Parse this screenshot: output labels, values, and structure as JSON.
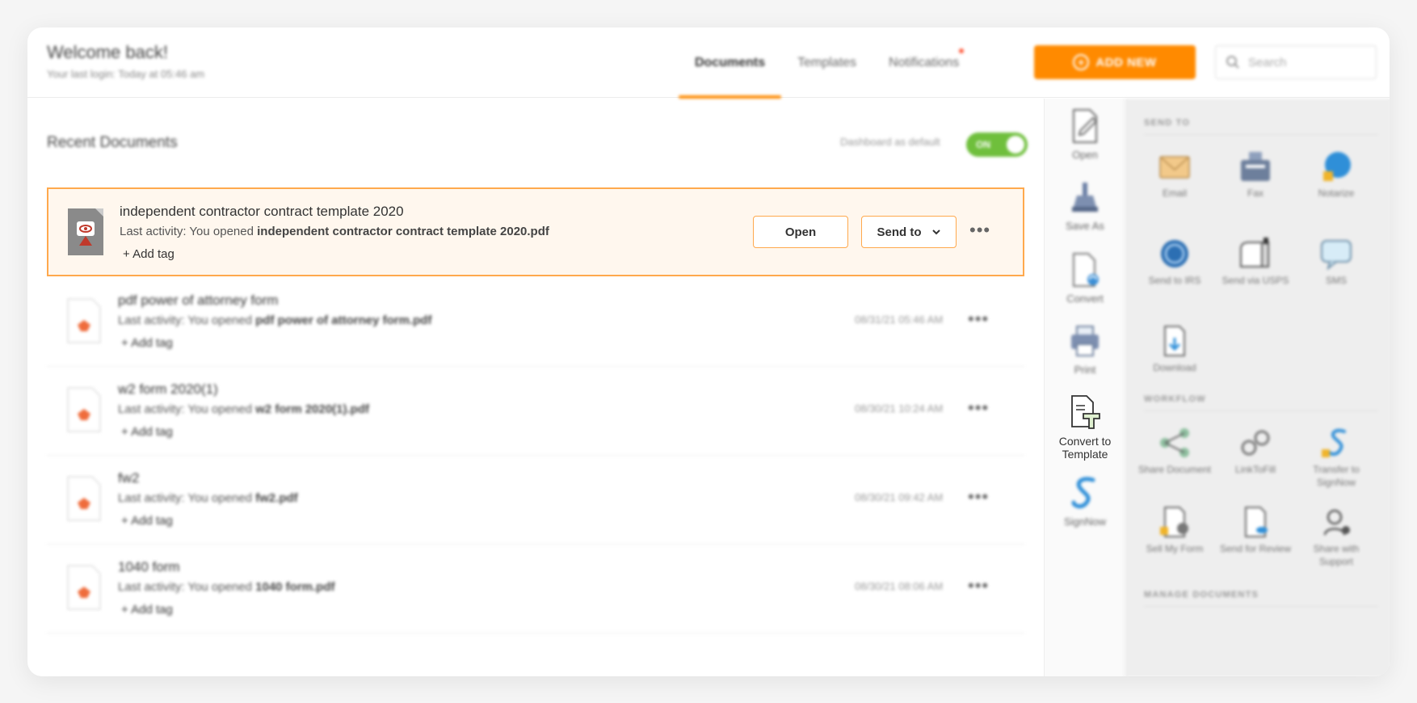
{
  "header": {
    "welcome_title": "Welcome back!",
    "last_login": "Your last login: Today at 05:46 am",
    "tabs": [
      {
        "label": "Documents",
        "active": true
      },
      {
        "label": "Templates",
        "active": false
      },
      {
        "label": "Notifications",
        "active": false,
        "has_dot": true
      }
    ],
    "add_new_label": "ADD NEW",
    "search_placeholder": "Search"
  },
  "main": {
    "title": "Recent Documents",
    "dashboard_default_label": "Dashboard as default",
    "toggle_label": "ON",
    "selected_doc": {
      "name": "independent contractor contract template 2020",
      "activity_prefix": "Last activity: You opened ",
      "activity_file": "independent contractor contract template 2020.pdf",
      "add_tag": "+ Add tag",
      "open_label": "Open",
      "send_to_label": "Send to"
    },
    "docs": [
      {
        "name": "pdf power of attorney form",
        "activity_prefix": "Last activity: You opened ",
        "activity_file": "pdf power of attorney form.pdf",
        "add_tag": "+ Add tag",
        "date": "08/31/21 05:46 AM"
      },
      {
        "name": "w2 form 2020(1)",
        "activity_prefix": "Last activity: You opened ",
        "activity_file": "w2 form 2020(1).pdf",
        "add_tag": "+ Add tag",
        "date": "08/30/21 10:24 AM"
      },
      {
        "name": "fw2",
        "activity_prefix": "Last activity: You opened ",
        "activity_file": "fw2.pdf",
        "add_tag": "+ Add tag",
        "date": "08/30/21 09:42 AM"
      },
      {
        "name": "1040 form",
        "activity_prefix": "Last activity: You opened ",
        "activity_file": "1040 form.pdf",
        "add_tag": "+ Add tag",
        "date": "08/30/21 08:06 AM"
      }
    ],
    "more_label": "•••"
  },
  "actions": [
    {
      "label": "Open",
      "icon": "open-icon"
    },
    {
      "label": "Save As",
      "icon": "save-as-icon"
    },
    {
      "label": "Convert",
      "icon": "convert-icon"
    },
    {
      "label": "Print",
      "icon": "print-icon"
    },
    {
      "label": "Convert to Template",
      "icon": "convert-to-template-icon"
    },
    {
      "label": "SignNow",
      "icon": "signnow-icon"
    }
  ],
  "panel": {
    "send_to_heading": "SEND TO",
    "send_to_items": [
      {
        "label": "Email",
        "icon": "email-icon"
      },
      {
        "label": "Fax",
        "icon": "fax-icon"
      },
      {
        "label": "Notarize",
        "icon": "notarize-icon"
      },
      {
        "label": "Send to IRS",
        "icon": "irs-icon"
      },
      {
        "label": "Send via USPS",
        "icon": "usps-icon"
      },
      {
        "label": "SMS",
        "icon": "sms-icon"
      },
      {
        "label": "Download",
        "icon": "download-icon"
      }
    ],
    "workflow_heading": "WORKFLOW",
    "workflow_items": [
      {
        "label": "Share Document",
        "icon": "share-icon"
      },
      {
        "label": "LinkToFill",
        "icon": "link-icon"
      },
      {
        "label": "Transfer to SignNow",
        "icon": "transfer-icon"
      },
      {
        "label": "Sell My Form",
        "icon": "sell-form-icon"
      },
      {
        "label": "Send for Review",
        "icon": "review-icon"
      },
      {
        "label": "Share with Support",
        "icon": "support-icon"
      }
    ],
    "manage_heading": "MANAGE DOCUMENTS"
  },
  "colors": {
    "accent": "#ff8a00",
    "toggle_on": "#6fbf3c",
    "selected_bg": "#fff7ee"
  }
}
